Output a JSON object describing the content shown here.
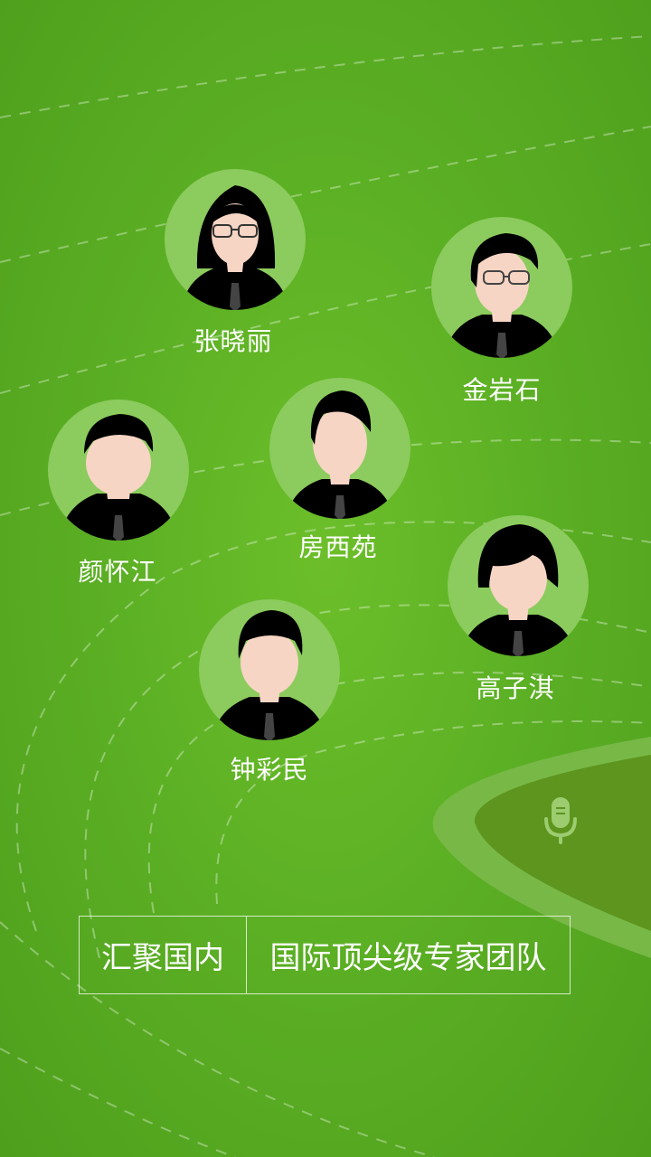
{
  "experts": [
    {
      "name": "张晓丽",
      "hair": "female-glasses"
    },
    {
      "name": "金岩石",
      "hair": "male-glasses"
    },
    {
      "name": "房西苑",
      "hair": "male-parted"
    },
    {
      "name": "颜怀江",
      "hair": "male-short"
    },
    {
      "name": "高子淇",
      "hair": "bob"
    },
    {
      "name": "钟彩民",
      "hair": "male-short"
    }
  ],
  "banner": {
    "left": "汇聚国内",
    "right": "国际顶尖级专家团队"
  },
  "icons": {
    "mic": "microphone-icon"
  },
  "colors": {
    "background": "#5cb024",
    "accent_dark": "#5c8f1c",
    "avatar_circle": "#8ccb5e"
  }
}
